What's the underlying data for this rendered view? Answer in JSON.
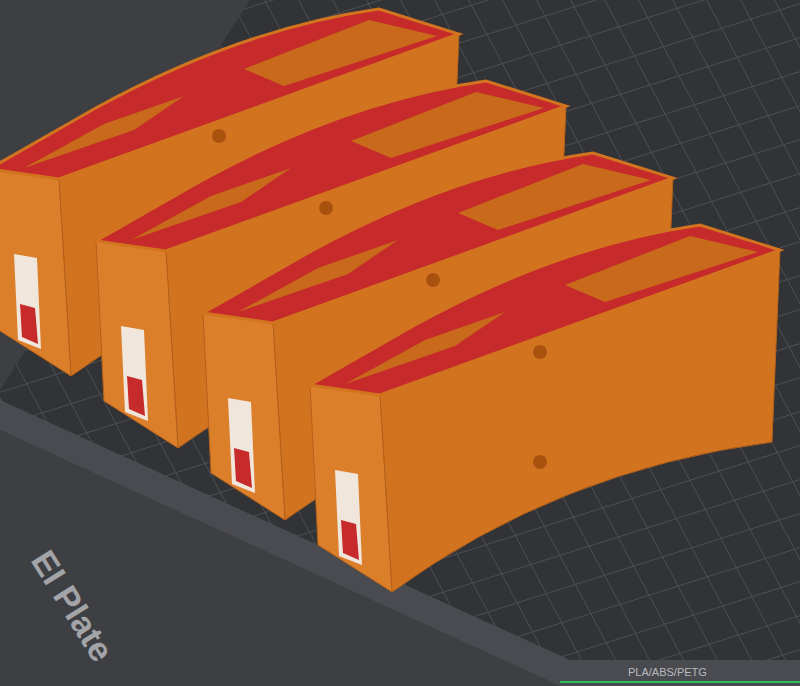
{
  "viewport": {
    "plate_label": "EI Plate",
    "filament_label": "PLA/ABS/PETG"
  }
}
